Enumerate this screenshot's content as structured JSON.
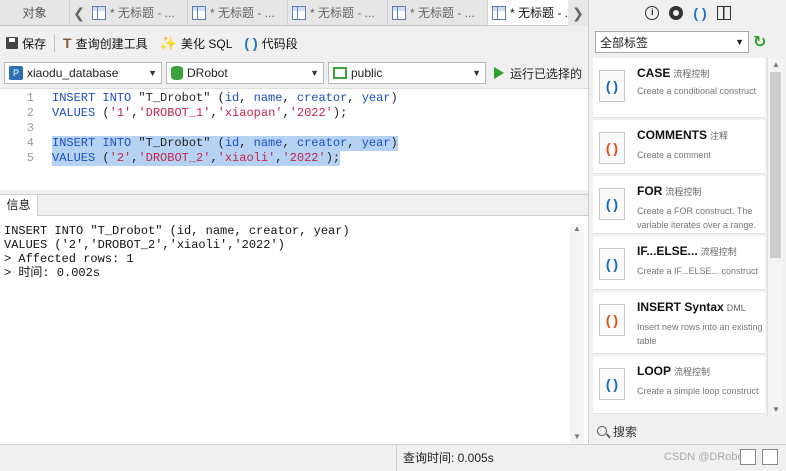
{
  "tabbar": {
    "objects_label": "对象",
    "tabs": [
      {
        "label": "* 无标题 - ..."
      },
      {
        "label": "* 无标题 - ..."
      },
      {
        "label": "* 无标题 - ..."
      },
      {
        "label": "* 无标题 - ..."
      },
      {
        "label": "* 无标题 - ..."
      }
    ]
  },
  "toolbar": {
    "save_label": "保存",
    "query_builder_label": "查询创建工具",
    "beautify_label": "美化 SQL",
    "snippet_label": "代码段"
  },
  "selectors": {
    "connection": "xiaodu_database",
    "database": "DRobot",
    "schema": "public",
    "run_label": "运行已选择的"
  },
  "editor": {
    "lines": [
      {
        "num": "1",
        "parts": [
          [
            "kw",
            "INSERT INTO "
          ],
          [
            "plain",
            "\"T_Drobot\" ("
          ],
          [
            "kw",
            "id"
          ],
          [
            "plain",
            ", "
          ],
          [
            "kw",
            "name"
          ],
          [
            "plain",
            ", "
          ],
          [
            "kw",
            "creator"
          ],
          [
            "plain",
            ", "
          ],
          [
            "kw",
            "year"
          ],
          [
            "plain",
            ")"
          ]
        ]
      },
      {
        "num": "2",
        "parts": [
          [
            "kw",
            "VALUES "
          ],
          [
            "plain",
            "("
          ],
          [
            "str",
            "'1'"
          ],
          [
            "plain",
            ","
          ],
          [
            "str",
            "'DROBOT_1'"
          ],
          [
            "plain",
            ","
          ],
          [
            "str",
            "'xiaopan'"
          ],
          [
            "plain",
            ","
          ],
          [
            "str",
            "'2022'"
          ],
          [
            "plain",
            ");"
          ]
        ]
      },
      {
        "num": "3",
        "parts": []
      },
      {
        "num": "4",
        "parts": [
          [
            "kw",
            "INSERT INTO "
          ],
          [
            "plain",
            "\"T_Drobot\" ("
          ],
          [
            "kw",
            "id"
          ],
          [
            "plain",
            ", "
          ],
          [
            "kw",
            "name"
          ],
          [
            "plain",
            ", "
          ],
          [
            "kw",
            "creator"
          ],
          [
            "plain",
            ", "
          ],
          [
            "kw",
            "year"
          ],
          [
            "plain",
            ")"
          ]
        ]
      },
      {
        "num": "5",
        "parts": [
          [
            "kw",
            "VALUES "
          ],
          [
            "plain",
            "("
          ],
          [
            "str",
            "'2'"
          ],
          [
            "plain",
            ","
          ],
          [
            "str",
            "'DROBOT_2'"
          ],
          [
            "plain",
            ","
          ],
          [
            "str",
            "'xiaoli'"
          ],
          [
            "plain",
            ","
          ],
          [
            "str",
            "'2022'"
          ],
          [
            "plain",
            ");"
          ]
        ]
      }
    ]
  },
  "info": {
    "tab_label": "信息",
    "output": [
      "INSERT INTO \"T_Drobot\" (id, name, creator, year)",
      "VALUES ('2','DROBOT_2','xiaoli','2022')",
      "> Affected rows: 1",
      "> 时间: 0.002s"
    ]
  },
  "status": {
    "query_time": "查询时间: 0.005s",
    "watermark": "CSDN @DRobot"
  },
  "right_panel": {
    "filter_value": "全部标签",
    "search_label": "搜索",
    "snippets": [
      {
        "name": "CASE",
        "category": "流程控制",
        "desc": "Create a conditional construct"
      },
      {
        "name": "COMMENTS",
        "category": "注释",
        "desc": "Create a comment"
      },
      {
        "name": "FOR",
        "category": "流程控制",
        "desc": "Create a FOR construct. The variable iterates over a range."
      },
      {
        "name": "IF...ELSE...",
        "category": "流程控制",
        "desc": "Create a IF...ELSE... construct"
      },
      {
        "name": "INSERT Syntax",
        "category": "DML",
        "desc": "Insert new rows into an existing table"
      },
      {
        "name": "LOOP",
        "category": "流程控制",
        "desc": "Create a simple loop construct"
      }
    ]
  }
}
